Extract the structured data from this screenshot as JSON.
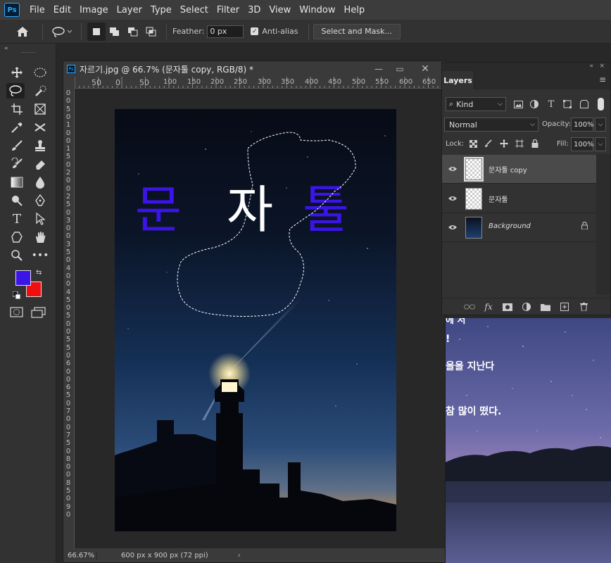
{
  "app": {
    "logo_text": "Ps"
  },
  "menu": [
    "File",
    "Edit",
    "Image",
    "Layer",
    "Type",
    "Select",
    "Filter",
    "3D",
    "View",
    "Window",
    "Help"
  ],
  "options_bar": {
    "feather_label": "Feather:",
    "feather_value": "0 px",
    "antialias_label": "Anti-alias",
    "antialias_checked": true,
    "select_mask_label": "Select and Mask..."
  },
  "tools": {
    "foreground_color": "#3b14e8",
    "background_color": "#ee1010",
    "items": [
      "move-tool",
      "marquee-tool",
      "lasso-tool",
      "quick-selection-tool",
      "crop-tool",
      "frame-tool",
      "eyedropper-tool",
      "healing-tool",
      "brush-tool",
      "stamp-tool",
      "history-brush-tool",
      "eraser-tool",
      "gradient-tool",
      "blur-tool",
      "dodge-tool",
      "pen-tool",
      "type-tool",
      "path-selection-tool",
      "shape-tool",
      "hand-tool",
      "zoom-tool",
      "more-tools"
    ]
  },
  "document": {
    "title": "자르기.jpg @ 66.7% (문자툴 copy, RGB/8) *",
    "zoom": "66.67%",
    "size_info": "600 px x 900 px (72 ppi)",
    "h_ruler_labels": [
      "50",
      "0",
      "50",
      "100",
      "150",
      "200",
      "250",
      "300",
      "350",
      "400",
      "450",
      "500",
      "550",
      "600",
      "650"
    ],
    "v_ruler_labels": [
      "0",
      "0",
      "5",
      "0",
      "1",
      "0",
      "0",
      "1",
      "5",
      "0",
      "2",
      "0",
      "0",
      "2",
      "5",
      "0",
      "3",
      "0",
      "0",
      "3",
      "5",
      "0",
      "4",
      "0",
      "0",
      "4",
      "5",
      "0",
      "5",
      "0",
      "0",
      "5",
      "5",
      "0",
      "6",
      "0",
      "0",
      "6",
      "5",
      "0",
      "7",
      "0",
      "0",
      "7",
      "5",
      "0",
      "8",
      "0",
      "0",
      "8",
      "5",
      "0",
      "9",
      "0"
    ],
    "canvas_text": {
      "char1": "문",
      "char2": "자",
      "char3": "툴"
    }
  },
  "layers_panel": {
    "title": "Layers",
    "kind_label": "Kind",
    "blend_mode": "Normal",
    "opacity_label": "Opacity:",
    "opacity_value": "100%",
    "lock_label": "Lock:",
    "fill_label": "Fill:",
    "fill_value": "100%",
    "layers": [
      {
        "name": "문자툴 copy",
        "selected": true,
        "type": "text"
      },
      {
        "name": "문자툴",
        "selected": false,
        "type": "text"
      },
      {
        "name": "Background",
        "selected": false,
        "type": "image",
        "locked": true
      }
    ]
  },
  "background_window": {
    "lines": [
      "에 서 ",
      "!",
      "을을 지난다",
      "참 많이 떴다."
    ]
  }
}
